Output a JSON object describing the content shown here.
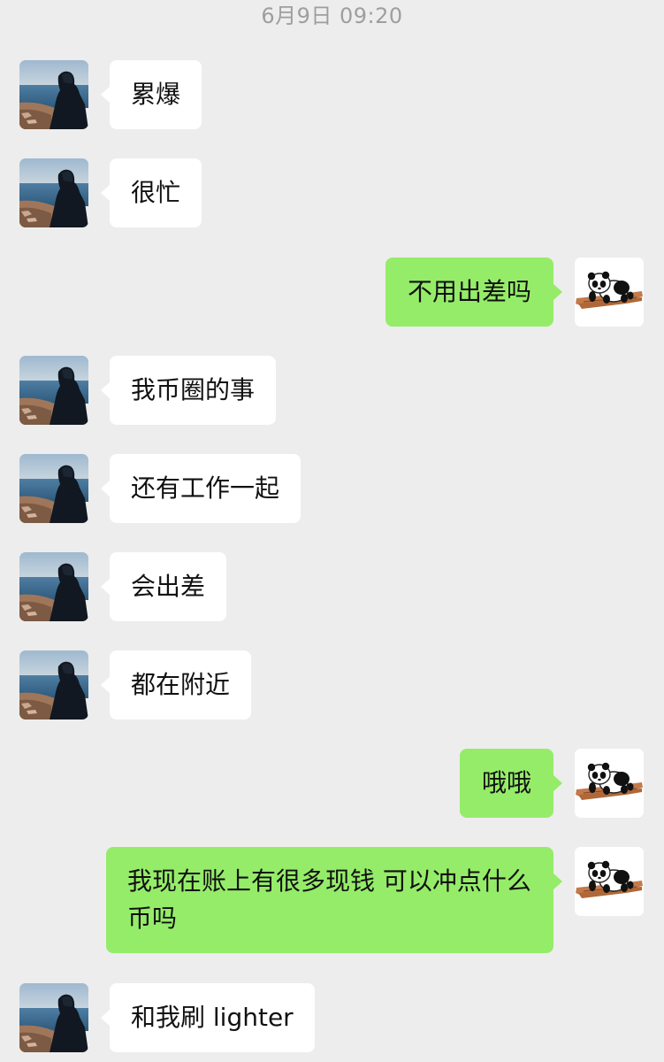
{
  "timestamp": "6月9日 09:20",
  "colors": {
    "background": "#ededed",
    "incoming_bubble": "#ffffff",
    "outgoing_bubble": "#95ec69",
    "timestamp_text": "#9e9e9e"
  },
  "messages": [
    {
      "side": "left",
      "avatar": "landscape-person-avatar",
      "text": "累爆"
    },
    {
      "side": "left",
      "avatar": "landscape-person-avatar",
      "text": "很忙"
    },
    {
      "side": "right",
      "avatar": "panda-avatar",
      "text": "不用出差吗"
    },
    {
      "side": "left",
      "avatar": "landscape-person-avatar",
      "text": "我币圈的事"
    },
    {
      "side": "left",
      "avatar": "landscape-person-avatar",
      "text": "还有工作一起"
    },
    {
      "side": "left",
      "avatar": "landscape-person-avatar",
      "text": "会出差"
    },
    {
      "side": "left",
      "avatar": "landscape-person-avatar",
      "text": "都在附近"
    },
    {
      "side": "right",
      "avatar": "panda-avatar",
      "text": "哦哦"
    },
    {
      "side": "right",
      "avatar": "panda-avatar",
      "text": "我现在账上有很多现钱 可以冲点什么币吗"
    },
    {
      "side": "left",
      "avatar": "landscape-person-avatar",
      "text": "和我刷 lighter"
    }
  ]
}
